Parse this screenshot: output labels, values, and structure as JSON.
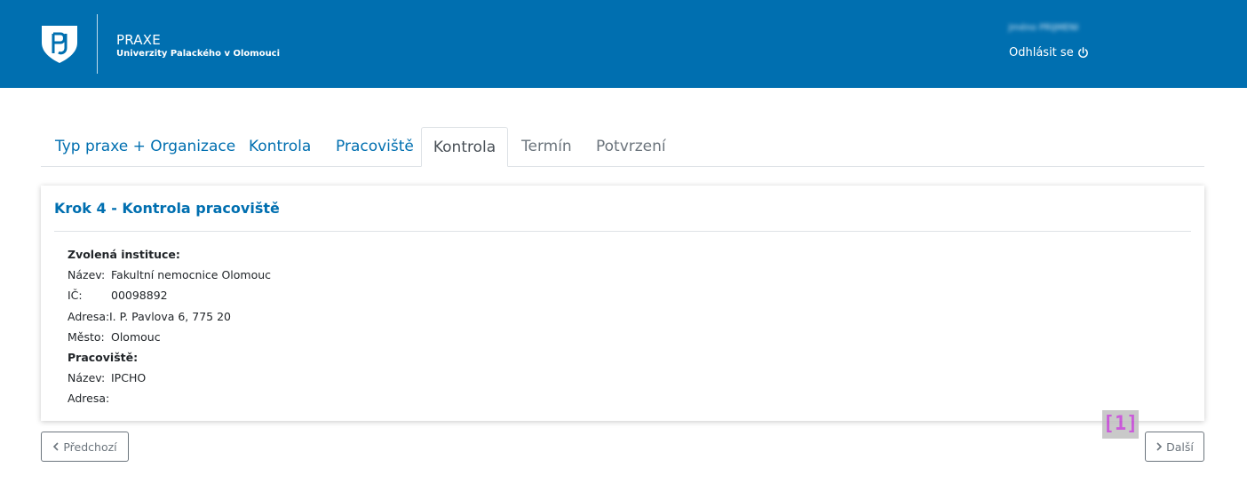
{
  "header": {
    "app_title": "PRAXE",
    "app_subtitle": "Univerzity Palackého v Olomouci",
    "user_name": "Jméno PŘÍJMENÍ",
    "logout_label": "Odhlásit se",
    "logo_icon": "upol-shield-logo-icon",
    "background_color": "#006fb0"
  },
  "tabs": [
    {
      "label": "Typ praxe + Organizace",
      "state": "link"
    },
    {
      "label": "Kontrola",
      "state": "link"
    },
    {
      "label": "Pracoviště",
      "state": "link"
    },
    {
      "label": "Kontrola",
      "state": "active"
    },
    {
      "label": "Termín",
      "state": "disabled"
    },
    {
      "label": "Potvrzení",
      "state": "disabled"
    }
  ],
  "card": {
    "title": "Krok 4 - Kontrola pracoviště",
    "institution_heading": "Zvolená instituce:",
    "institution": [
      {
        "label": "Název:",
        "value": "Fakultní nemocnice Olomouc"
      },
      {
        "label": "IČ:",
        "value": "00098892"
      },
      {
        "label": "Adresa:",
        "value": "I. P. Pavlova 6, 775 20"
      },
      {
        "label": "Město:",
        "value": "Olomouc"
      }
    ],
    "workplace_heading": "Pracoviště:",
    "workplace": [
      {
        "label": "Název:",
        "value": "IPCHO"
      },
      {
        "label": "Adresa:",
        "value": ""
      }
    ]
  },
  "buttons": {
    "prev_label": "Předchozí",
    "next_label": "Další"
  },
  "marker": {
    "label": "[1]"
  }
}
